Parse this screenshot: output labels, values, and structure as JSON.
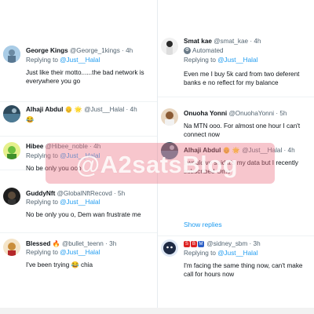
{
  "left_tweets": [
    {
      "name": "George Kings",
      "handle": "@George_1kings · 4h",
      "replying_prefix": "Replying to",
      "replying_mention": "@Just__Halal",
      "text": "Just like their motto......the bad network is everywhere you go",
      "avatar_color": "#9fc3e0"
    },
    {
      "name": "Alhaji Abdul",
      "name_emoji": "👴 🌟",
      "handle": "@Just__Halal · 4h",
      "text": "😂",
      "avatar_color": "#3a5566"
    },
    {
      "name": "Hibee",
      "handle": "@Hibee_noble · 4h",
      "replying_prefix": "Replying to",
      "replying_mention": "@Just__Halal",
      "text": "No be only you ooo",
      "avatar_color": "#d9e85a"
    },
    {
      "name": "GuddyNft",
      "handle": "@GlobalNftRecovd · 5h",
      "replying_prefix": "Replying to",
      "replying_mention": "@Just__Halal",
      "text": "No be only you o, Dem wan frustrate me",
      "avatar_color": "#2b2b2b"
    },
    {
      "name": "Blessed",
      "name_emoji": "🔥",
      "handle": "@bullet_teenn · 3h",
      "replying_prefix": "Replying to",
      "replying_mention": "@Just__Halal",
      "text": "I've been trying 😂 chia",
      "avatar_color": "#c98d3a"
    }
  ],
  "right_tweets": [
    {
      "name": "Smat kae",
      "handle": "@smat_kae · 4h",
      "automated": "Automated",
      "replying_prefix": "Replying to",
      "replying_mention": "@Just__Halal",
      "text": "Even me I buy 5k card from two deferent banks e no reflect for my balance",
      "avatar_color": "#e8e8e8"
    },
    {
      "name": "Onuoha Yonni",
      "handle": "@OnuohaYonni · 5h",
      "text": "Na MTN ooo. For almost one hour I can't connect now",
      "avatar_color": "#c89a6a"
    },
    {
      "name": "Alhaji Abdul",
      "name_emoji": "👴 🌟",
      "handle": "@Just__Halal · 4h",
      "text": "I would've said it's my data but I recently subscribed Omo",
      "avatar_color": "#3a5566"
    },
    {
      "name": "SBM",
      "handle": "@sidney_sbm · 3h",
      "replying_prefix": "Replying to",
      "replying_mention": "@Just__Halal",
      "text": "I'm facing the same thing now, can't make call for hours now",
      "avatar_color": "#1e2a44"
    }
  ],
  "show_replies": "Show replies",
  "watermark": "@A2satsBlog",
  "colors": {
    "link_blue": "#1d9bf0",
    "muted_gray": "#536471",
    "watermark_band": "#eb7887"
  }
}
